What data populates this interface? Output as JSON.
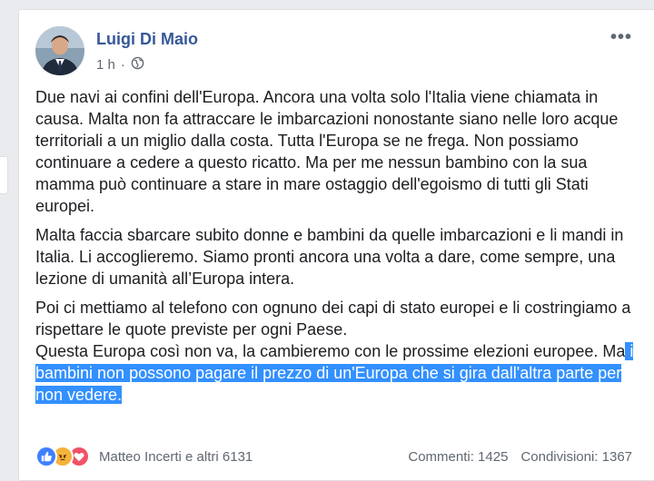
{
  "post": {
    "author": "Luigi Di Maio",
    "time": "1 h",
    "paragraph1": "Due navi ai confini dell'Europa. Ancora una volta solo l'Italia viene chiamata in causa. Malta non fa attraccare le imbarcazioni nonostante siano nelle loro acque territoriali a un miglio dalla costa. Tutta l'Europa se ne frega. Non possiamo continuare a cedere a questo ricatto. Ma per me nessun bambino con la sua mamma può continuare a stare in mare ostaggio dell'egoismo di tutti gli Stati europei.",
    "paragraph2": "Malta faccia sbarcare subito donne e bambini da quelle imbarcazioni e li mandi in Italia. Li accoglieremo. Siamo pronti ancora una volta a dare, come sempre, una lezione di umanità all’Europa intera.",
    "paragraph3_line1": "Poi ci mettiamo al telefono con ognuno dei capi di stato europei e li costringiamo a rispettare le quote previste per ogni Paese.",
    "paragraph3_line2_start": "Questa Europa così non va, la cambieremo con le prossime elezioni europee. Ma",
    "paragraph3_highlight": " i bambini non possono pagare il prezzo di un'Europa che si gira dall'altra parte per non vedere."
  },
  "footer": {
    "reactions_text": "Matteo Incerti e altri 6131",
    "comments": "Commenti: 1425",
    "shares": "Condivisioni: 1367"
  },
  "icons": {
    "more": "more-horizontal-icon",
    "privacy": "globe-icon",
    "reactions": [
      "like-icon",
      "angry-icon",
      "love-icon"
    ]
  },
  "colors": {
    "author_link": "#365899",
    "selection_highlight": "#3390ff",
    "like": "#4080ff",
    "angry": "#f5b33b",
    "love": "#f25268"
  }
}
